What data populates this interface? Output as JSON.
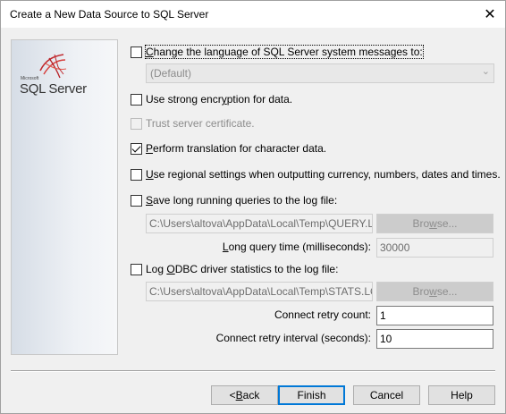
{
  "window": {
    "title": "Create a New Data Source to SQL Server",
    "close_glyph": "✕"
  },
  "logo": {
    "small": "Microsoft",
    "text": "SQL Server"
  },
  "options": {
    "change_language": {
      "pre": "",
      "ul": "C",
      "post": "hange the language of SQL Server system messages to:",
      "checked": false
    },
    "language_value": "(Default)",
    "strong_encryption": {
      "pre": "Use strong encr",
      "ul": "y",
      "post": "ption for data.",
      "checked": false
    },
    "trust_cert": {
      "label": "Trust server certificate.",
      "checked": false,
      "disabled": true
    },
    "translation": {
      "pre": "",
      "ul": "P",
      "post": "erform translation for character data.",
      "checked": true
    },
    "regional": {
      "pre": "",
      "ul": "U",
      "post": "se regional settings when outputting currency, numbers, dates and times.",
      "checked": false
    },
    "save_long": {
      "pre": "",
      "ul": "S",
      "post": "ave long running queries to the log file:",
      "checked": false
    },
    "query_log_path": "C:\\Users\\altova\\AppData\\Local\\Temp\\QUERY.LOG",
    "long_query_label": {
      "pre": "",
      "ul": "L",
      "post": "ong query time (milliseconds):"
    },
    "long_query_value": "30000",
    "log_odbc": {
      "pre": "Log ",
      "ul": "O",
      "post": "DBC driver statistics to the log file:",
      "checked": false
    },
    "stats_log_path": "C:\\Users\\altova\\AppData\\Local\\Temp\\STATS.LOG",
    "browse_pre": "Bro",
    "browse_ul": "w",
    "browse_post": "se...",
    "retry_count_label": "Connect retry count:",
    "retry_count_value": "1",
    "retry_interval_label": "Connect retry interval (seconds):",
    "retry_interval_value": "10"
  },
  "buttons": {
    "back_pre": "< ",
    "back_ul": "B",
    "back_post": "ack",
    "finish": "Finish",
    "cancel": "Cancel",
    "help": "Help"
  }
}
